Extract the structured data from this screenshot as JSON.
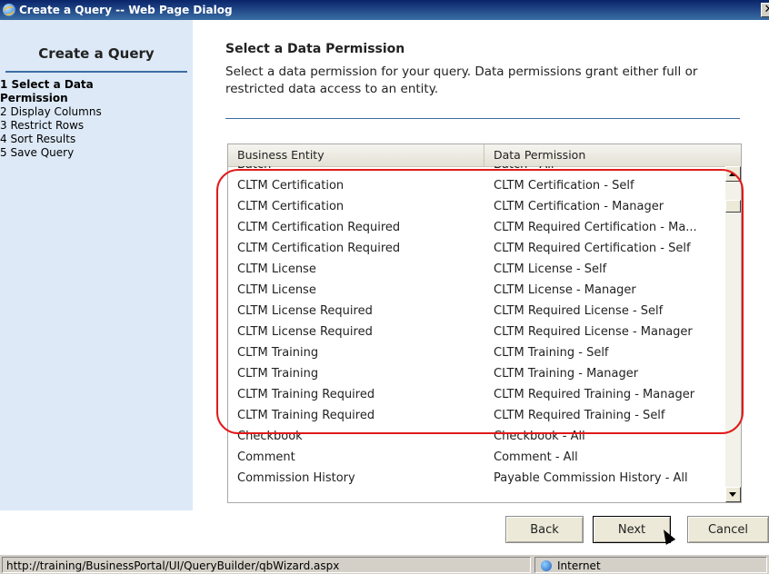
{
  "window": {
    "title": "Create a Query -- Web Page Dialog",
    "close_symbol": "✕"
  },
  "sidebar": {
    "title": "Create a Query",
    "steps": [
      {
        "label": "1 Select a Data Permission",
        "active": true
      },
      {
        "label": "2 Display Columns",
        "active": false
      },
      {
        "label": "3 Restrict Rows",
        "active": false
      },
      {
        "label": "4 Sort Results",
        "active": false
      },
      {
        "label": "5 Save Query",
        "active": false
      }
    ]
  },
  "main": {
    "title": "Select a Data Permission",
    "description": "Select a data permission for your query. Data permissions grant either full or restricted data access to an entity."
  },
  "grid": {
    "columns": [
      "Business Entity",
      "Data Permission"
    ],
    "rows": [
      [
        "Batch",
        "Batch - All"
      ],
      [
        "CLTM Certification",
        "CLTM Certification - Self"
      ],
      [
        "CLTM Certification",
        "CLTM Certification - Manager"
      ],
      [
        "CLTM Certification Required",
        "CLTM Required Certification - Ma..."
      ],
      [
        "CLTM Certification Required",
        "CLTM Required Certification - Self"
      ],
      [
        "CLTM License",
        "CLTM License - Self"
      ],
      [
        "CLTM License",
        "CLTM License - Manager"
      ],
      [
        "CLTM License Required",
        "CLTM Required License - Self"
      ],
      [
        "CLTM License Required",
        "CLTM Required License - Manager"
      ],
      [
        "CLTM Training",
        "CLTM Training - Self"
      ],
      [
        "CLTM Training",
        "CLTM Training - Manager"
      ],
      [
        "CLTM Training Required",
        "CLTM Required Training - Manager"
      ],
      [
        "CLTM Training Required",
        "CLTM Required Training - Self"
      ],
      [
        "Checkbook",
        "Checkbook - All"
      ],
      [
        "Comment",
        "Comment - All"
      ],
      [
        "Commission History",
        "Payable Commission History - All"
      ]
    ]
  },
  "buttons": {
    "back": "Back",
    "next": "Next",
    "cancel": "Cancel"
  },
  "statusbar": {
    "url": "http://training/BusinessPortal/UI/QueryBuilder/qbWizard.aspx",
    "zone": "Internet"
  },
  "colors": {
    "highlight": "#e01a1a",
    "sidebar_bg": "#dde9f7",
    "title_bar": "#0a246a"
  }
}
